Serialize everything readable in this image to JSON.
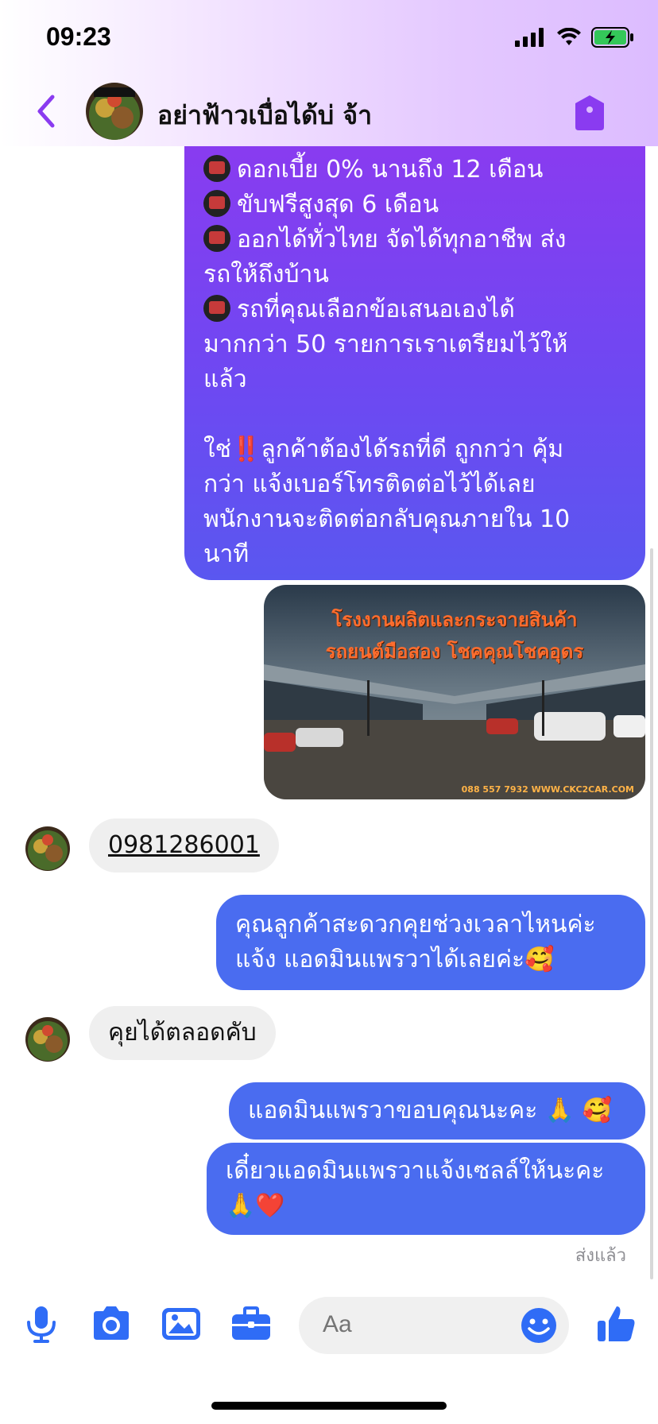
{
  "status_bar": {
    "time": "09:23"
  },
  "header": {
    "title": "อย่าฟ้าวเบื่อได้บ่ จ้า"
  },
  "messages": {
    "promo_lines": [
      {
        "emoji": true,
        "text": "ดอกเบี้ย 0% นานถึง 12 เดือน"
      },
      {
        "emoji": true,
        "text": "ขับฟรีสูงสุด 6 เดือน"
      },
      {
        "emoji": true,
        "text": "ออกได้ทั่วไทย จัดได้ทุกอาชีพ ส่ง"
      },
      {
        "emoji": false,
        "text": "รถให้ถึงบ้าน"
      },
      {
        "emoji": true,
        "text": "รถที่คุณเลือกข้อเสนอเองได้"
      },
      {
        "emoji": false,
        "text": "มากกว่า 50 รายการเราเตรียมไว้ให้"
      },
      {
        "emoji": false,
        "text": "แล้ว"
      }
    ],
    "promo_tail": {
      "line1_a": "ใช่",
      "line1_bang": "‼️",
      "line1_b": "ลูกค้าต้องได้รถที่ดี ถูกกว่า คุ้ม",
      "line2": "กว่า แจ้งเบอร์โทรติดต่อไว้ได้เลย",
      "line3": "พนักงานจะติดต่อกลับคุณภายใน 10",
      "line4": "นาที"
    },
    "photo": {
      "title1": "โรงงานผลิตและกระจายสินค้า",
      "title2": "รถยนต์มือสอง โชคคุณโชคอุดร",
      "footer": "088 557 7932 WWW.CKC2CAR.COM"
    },
    "incoming_phone": "0981286001",
    "outgoing_1": {
      "line1": "คุณลูกค้าสะดวกคุยช่วงเวลาไหนค่ะ",
      "line2": "แจ้ง แอดมินแพรวาได้เลยค่ะ🥰"
    },
    "incoming_2": "คุยได้ตลอดคับ",
    "outgoing_2": "แอดมินแพรวาขอบคุณนะคะ 🙏 🥰",
    "outgoing_3": {
      "line1": "เดี๋ยวแอดมินแพรวาแจ้งเซลล์ให้นะคะ",
      "line2": "🙏❤️"
    },
    "receipt": "ส่งแล้ว"
  },
  "composer": {
    "placeholder": "Aa"
  },
  "colors": {
    "accent": "#8a3bf0",
    "blue_bubble": "#4a6cf0",
    "incoming_bubble": "#efefef"
  }
}
